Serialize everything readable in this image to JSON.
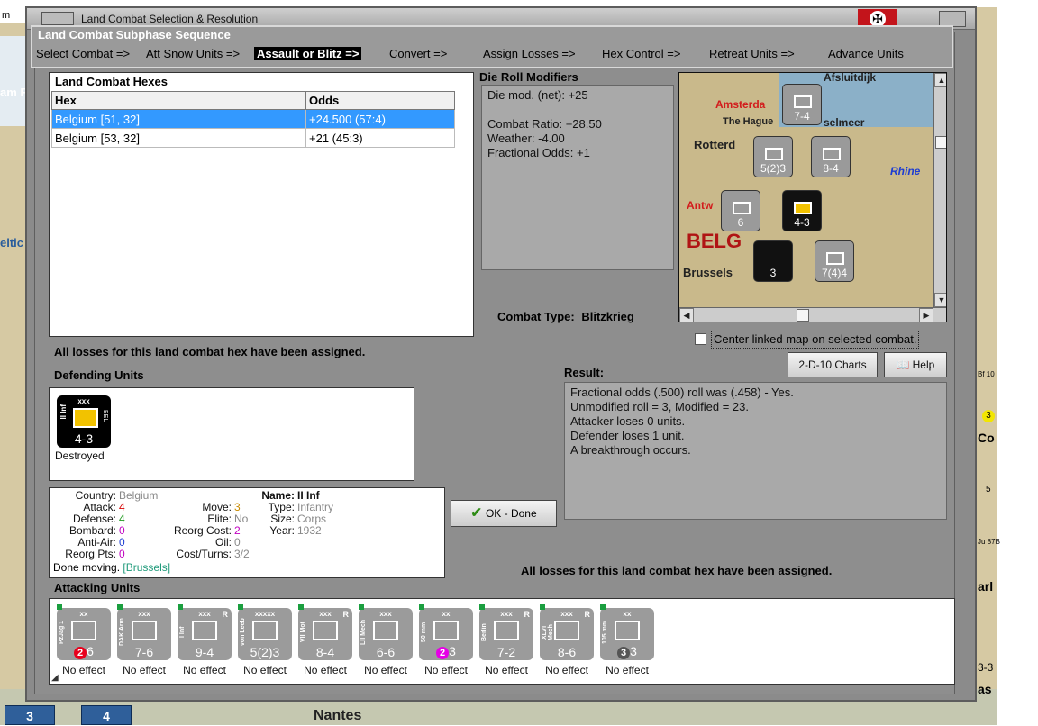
{
  "window": {
    "title": "Land Combat Selection & Resolution",
    "outer_title": "m",
    "side_labels": [
      "am F",
      "eltic",
      "Al"
    ],
    "bottom_counts": [
      "3",
      "4"
    ],
    "bottom_city": "Nantes",
    "right_map_labels": [
      "Bf 10",
      "3",
      "Co",
      "5",
      "Ju 87B",
      "arl",
      "3-3",
      "as"
    ]
  },
  "sequence": {
    "title": "Land Combat Subphase Sequence",
    "items": [
      "Select Combat =>",
      "Att Snow Units =>",
      "Assault or Blitz =>",
      "Convert =>",
      "Assign Losses =>",
      "Hex Control =>",
      "Retreat Units =>",
      "Advance Units"
    ],
    "active_index": 2
  },
  "hexes": {
    "title": "Land Combat Hexes",
    "columns": [
      "Hex",
      "Odds"
    ],
    "rows": [
      {
        "hex": "Belgium [51, 32]",
        "odds": "+24.500 (57:4)",
        "selected": true
      },
      {
        "hex": "Belgium [53, 32]",
        "odds": "+21 (45:3)",
        "selected": false
      }
    ]
  },
  "drm": {
    "title": "Die Roll Modifiers",
    "lines": [
      "Die mod. (net): +25",
      "",
      "Combat Ratio: +28.50",
      "Weather: -4.00",
      "Fractional Odds: +1"
    ]
  },
  "minimap": {
    "labels": [
      "Afsluitdijk",
      "Amsterda",
      "The Hague",
      "selmeer",
      "Rotterd",
      "Rhine",
      "Antw",
      "BELG",
      "Brussels"
    ],
    "counters": [
      {
        "str": "7-4",
        "size": "xx"
      },
      {
        "str": "5(2)3",
        "size": "xxxxx"
      },
      {
        "str": "8-4",
        "size": "xxx"
      },
      {
        "str": "6",
        "size": "xx"
      },
      {
        "str": "4-3",
        "size": "xxx"
      },
      {
        "str": "7(4)4",
        "size": "xxxxx"
      },
      {
        "str": "3",
        "size": "Bf 109"
      }
    ]
  },
  "combat_type": {
    "label": "Combat Type:",
    "value": "Blitzkrieg"
  },
  "center_checkbox": {
    "label": "Center linked map on selected combat.",
    "checked": false
  },
  "buttons": {
    "charts": "2-D-10 Charts",
    "help": "Help",
    "ok": "OK - Done"
  },
  "losses_message": "All losses for this land combat hex have been assigned.",
  "defending": {
    "title": "Defending Units",
    "units": [
      {
        "name": "II Inf",
        "size": "xxx",
        "strength": "4-3",
        "nation": "BEL",
        "status": "Destroyed"
      }
    ]
  },
  "unit_info": {
    "country_label": "Country:",
    "country": "Belgium",
    "attack_label": "Attack:",
    "attack": "4",
    "defense_label": "Defense:",
    "defense": "4",
    "bombard_label": "Bombard:",
    "bombard": "0",
    "antiair_label": "Anti-Air:",
    "antiair": "0",
    "reorgpts_label": "Reorg Pts:",
    "reorgpts": "0",
    "move_label": "Move:",
    "move": "3",
    "elite_label": "Elite:",
    "elite": "No",
    "reorgcost_label": "Reorg Cost:",
    "reorgcost": "2",
    "oil_label": "Oil:",
    "oil": "0",
    "costturns_label": "Cost/Turns:",
    "costturns": "3/2",
    "name_label": "Name:",
    "name": "II Inf",
    "type_label": "Type:",
    "type": "Infantry",
    "size_label": "Size:",
    "size": "Corps",
    "year_label": "Year:",
    "year": "1932",
    "status": "Done moving.",
    "location": "[Brussels]"
  },
  "result": {
    "title": "Result:",
    "lines": [
      "Fractional odds (.500) roll was (.458)  - Yes.",
      "Unmodified roll = 3, Modified = 23.",
      "Attacker loses 0 units.",
      "Defender loses 1 unit.",
      "A breakthrough occurs."
    ]
  },
  "attacking": {
    "title": "Attacking Units",
    "units": [
      {
        "name": "PzJag 1",
        "size": "xx",
        "badge": "2",
        "badge_color": "#e8001c",
        "str": "6",
        "effect": "No effect",
        "r": ""
      },
      {
        "name": "DAK Arm",
        "size": "xxx",
        "badge": "",
        "badge_color": "",
        "str": "7-6",
        "effect": "No effect",
        "r": ""
      },
      {
        "name": "I Inf",
        "size": "xxx",
        "badge": "",
        "badge_color": "",
        "str": "9-4",
        "effect": "No effect",
        "r": "R"
      },
      {
        "name": "von Leeb",
        "size": "xxxxx",
        "badge": "",
        "badge_color": "",
        "str": "5(2)3",
        "effect": "No effect",
        "r": ""
      },
      {
        "name": "VII Mot",
        "size": "xxx",
        "badge": "",
        "badge_color": "",
        "str": "8-4",
        "effect": "No effect",
        "r": "R"
      },
      {
        "name": "LII Mech",
        "size": "xxx",
        "badge": "",
        "badge_color": "",
        "str": "6-6",
        "effect": "No effect",
        "r": ""
      },
      {
        "name": "50 mm",
        "size": "xx",
        "badge": "2",
        "badge_color": "#e600e6",
        "str": "3",
        "effect": "No effect",
        "r": ""
      },
      {
        "name": "Berlin",
        "size": "xxx",
        "badge": "",
        "badge_color": "",
        "str": "7-2",
        "effect": "No effect",
        "r": "R"
      },
      {
        "name": "XLVI Mech",
        "size": "xxx",
        "badge": "",
        "badge_color": "",
        "str": "8-6",
        "effect": "No effect",
        "r": "R"
      },
      {
        "name": "105 mm",
        "size": "xx",
        "badge": "3",
        "badge_color": "#555555",
        "str": "3",
        "effect": "No effect",
        "r": ""
      }
    ]
  }
}
